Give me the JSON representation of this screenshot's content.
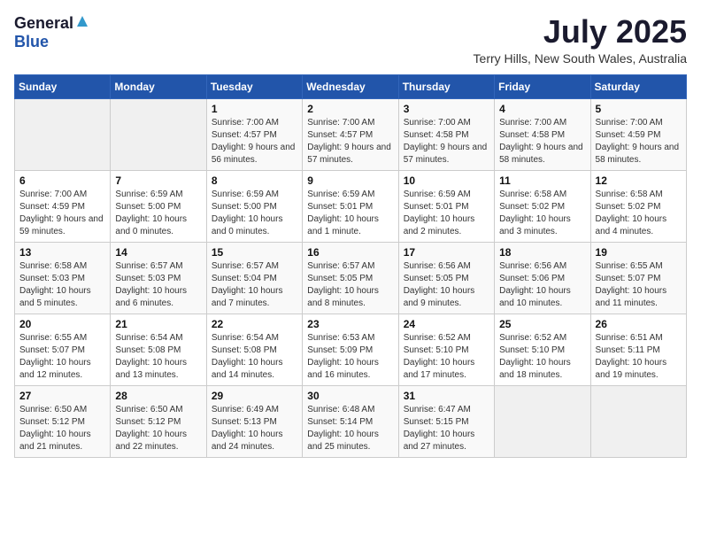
{
  "logo": {
    "general": "General",
    "blue": "Blue"
  },
  "title": "July 2025",
  "location": "Terry Hills, New South Wales, Australia",
  "days_of_week": [
    "Sunday",
    "Monday",
    "Tuesday",
    "Wednesday",
    "Thursday",
    "Friday",
    "Saturday"
  ],
  "weeks": [
    [
      {
        "day": "",
        "empty": true
      },
      {
        "day": "",
        "empty": true
      },
      {
        "day": "1",
        "sunrise": "7:00 AM",
        "sunset": "4:57 PM",
        "daylight": "9 hours and 56 minutes."
      },
      {
        "day": "2",
        "sunrise": "7:00 AM",
        "sunset": "4:57 PM",
        "daylight": "9 hours and 57 minutes."
      },
      {
        "day": "3",
        "sunrise": "7:00 AM",
        "sunset": "4:58 PM",
        "daylight": "9 hours and 57 minutes."
      },
      {
        "day": "4",
        "sunrise": "7:00 AM",
        "sunset": "4:58 PM",
        "daylight": "9 hours and 58 minutes."
      },
      {
        "day": "5",
        "sunrise": "7:00 AM",
        "sunset": "4:59 PM",
        "daylight": "9 hours and 58 minutes."
      }
    ],
    [
      {
        "day": "6",
        "sunrise": "7:00 AM",
        "sunset": "4:59 PM",
        "daylight": "9 hours and 59 minutes."
      },
      {
        "day": "7",
        "sunrise": "6:59 AM",
        "sunset": "5:00 PM",
        "daylight": "10 hours and 0 minutes."
      },
      {
        "day": "8",
        "sunrise": "6:59 AM",
        "sunset": "5:00 PM",
        "daylight": "10 hours and 0 minutes."
      },
      {
        "day": "9",
        "sunrise": "6:59 AM",
        "sunset": "5:01 PM",
        "daylight": "10 hours and 1 minute."
      },
      {
        "day": "10",
        "sunrise": "6:59 AM",
        "sunset": "5:01 PM",
        "daylight": "10 hours and 2 minutes."
      },
      {
        "day": "11",
        "sunrise": "6:58 AM",
        "sunset": "5:02 PM",
        "daylight": "10 hours and 3 minutes."
      },
      {
        "day": "12",
        "sunrise": "6:58 AM",
        "sunset": "5:02 PM",
        "daylight": "10 hours and 4 minutes."
      }
    ],
    [
      {
        "day": "13",
        "sunrise": "6:58 AM",
        "sunset": "5:03 PM",
        "daylight": "10 hours and 5 minutes."
      },
      {
        "day": "14",
        "sunrise": "6:57 AM",
        "sunset": "5:03 PM",
        "daylight": "10 hours and 6 minutes."
      },
      {
        "day": "15",
        "sunrise": "6:57 AM",
        "sunset": "5:04 PM",
        "daylight": "10 hours and 7 minutes."
      },
      {
        "day": "16",
        "sunrise": "6:57 AM",
        "sunset": "5:05 PM",
        "daylight": "10 hours and 8 minutes."
      },
      {
        "day": "17",
        "sunrise": "6:56 AM",
        "sunset": "5:05 PM",
        "daylight": "10 hours and 9 minutes."
      },
      {
        "day": "18",
        "sunrise": "6:56 AM",
        "sunset": "5:06 PM",
        "daylight": "10 hours and 10 minutes."
      },
      {
        "day": "19",
        "sunrise": "6:55 AM",
        "sunset": "5:07 PM",
        "daylight": "10 hours and 11 minutes."
      }
    ],
    [
      {
        "day": "20",
        "sunrise": "6:55 AM",
        "sunset": "5:07 PM",
        "daylight": "10 hours and 12 minutes."
      },
      {
        "day": "21",
        "sunrise": "6:54 AM",
        "sunset": "5:08 PM",
        "daylight": "10 hours and 13 minutes."
      },
      {
        "day": "22",
        "sunrise": "6:54 AM",
        "sunset": "5:08 PM",
        "daylight": "10 hours and 14 minutes."
      },
      {
        "day": "23",
        "sunrise": "6:53 AM",
        "sunset": "5:09 PM",
        "daylight": "10 hours and 16 minutes."
      },
      {
        "day": "24",
        "sunrise": "6:52 AM",
        "sunset": "5:10 PM",
        "daylight": "10 hours and 17 minutes."
      },
      {
        "day": "25",
        "sunrise": "6:52 AM",
        "sunset": "5:10 PM",
        "daylight": "10 hours and 18 minutes."
      },
      {
        "day": "26",
        "sunrise": "6:51 AM",
        "sunset": "5:11 PM",
        "daylight": "10 hours and 19 minutes."
      }
    ],
    [
      {
        "day": "27",
        "sunrise": "6:50 AM",
        "sunset": "5:12 PM",
        "daylight": "10 hours and 21 minutes."
      },
      {
        "day": "28",
        "sunrise": "6:50 AM",
        "sunset": "5:12 PM",
        "daylight": "10 hours and 22 minutes."
      },
      {
        "day": "29",
        "sunrise": "6:49 AM",
        "sunset": "5:13 PM",
        "daylight": "10 hours and 24 minutes."
      },
      {
        "day": "30",
        "sunrise": "6:48 AM",
        "sunset": "5:14 PM",
        "daylight": "10 hours and 25 minutes."
      },
      {
        "day": "31",
        "sunrise": "6:47 AM",
        "sunset": "5:15 PM",
        "daylight": "10 hours and 27 minutes."
      },
      {
        "day": "",
        "empty": true
      },
      {
        "day": "",
        "empty": true
      }
    ]
  ],
  "labels": {
    "sunrise_prefix": "Sunrise: ",
    "sunset_prefix": "Sunset: ",
    "daylight_prefix": "Daylight: "
  }
}
